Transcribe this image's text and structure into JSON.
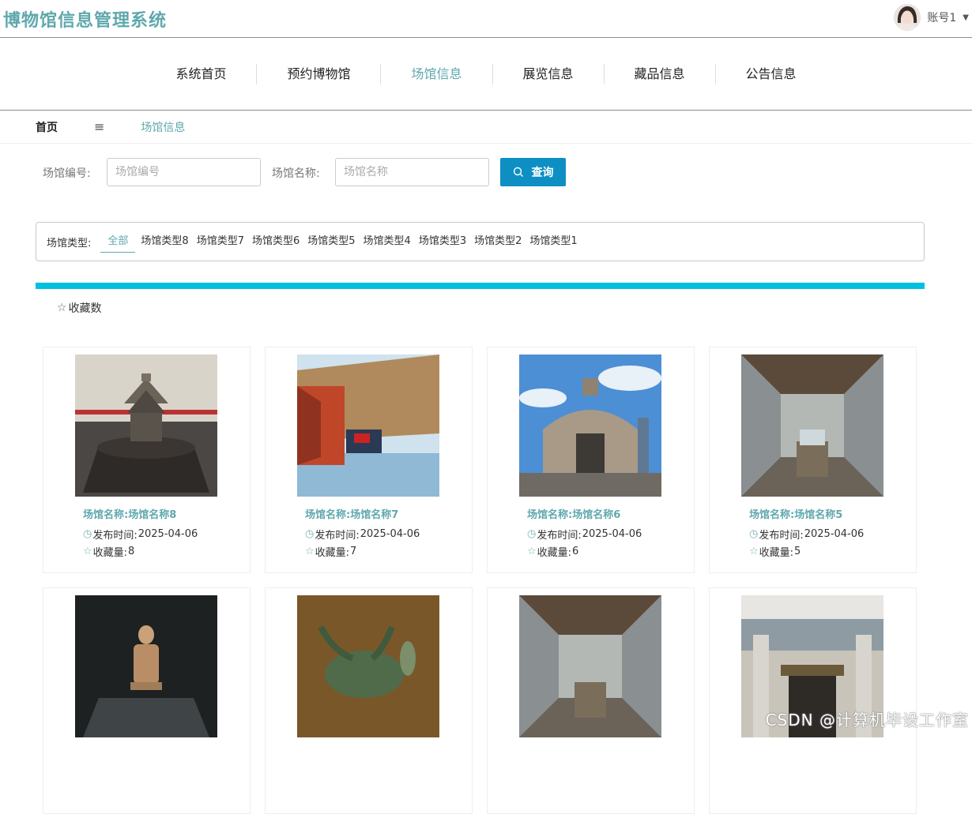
{
  "header": {
    "title": "博物馆信息管理系统",
    "user": "账号1"
  },
  "nav": [
    "系统首页",
    "预约博物馆",
    "场馆信息",
    "展览信息",
    "藏品信息",
    "公告信息"
  ],
  "nav_active_index": 2,
  "breadcrumb": {
    "home": "首页",
    "separator": "≡",
    "current": "场馆信息"
  },
  "search": {
    "code_label": "场馆编号:",
    "code_placeholder": "场馆编号",
    "code_value": "",
    "name_label": "场馆名称:",
    "name_placeholder": "场馆名称",
    "name_value": "",
    "button": "查询"
  },
  "types": {
    "label": "场馆类型:",
    "items": [
      "全部",
      "场馆类型8",
      "场馆类型7",
      "场馆类型6",
      "场馆类型5",
      "场馆类型4",
      "场馆类型3",
      "场馆类型2",
      "场馆类型1"
    ],
    "active_index": 0
  },
  "sort": {
    "label": "收藏数"
  },
  "cards": [
    {
      "name": "场馆名称:场馆名称8",
      "time_label": "发布时间:",
      "time": "2025-04-06",
      "fav_label": "收藏量:",
      "fav": "8"
    },
    {
      "name": "场馆名称:场馆名称7",
      "time_label": "发布时间:",
      "time": "2025-04-06",
      "fav_label": "收藏量:",
      "fav": "7"
    },
    {
      "name": "场馆名称:场馆名称6",
      "time_label": "发布时间:",
      "time": "2025-04-06",
      "fav_label": "收藏量:",
      "fav": "6"
    },
    {
      "name": "场馆名称:场馆名称5",
      "time_label": "发布时间:",
      "time": "2025-04-06",
      "fav_label": "收藏量:",
      "fav": "5"
    }
  ],
  "watermark": "CSDN @计算机毕设工作室",
  "colors": {
    "brand": "#5fa8ad",
    "button": "#0d8fc3",
    "accent_bar": "#00c0e0"
  }
}
